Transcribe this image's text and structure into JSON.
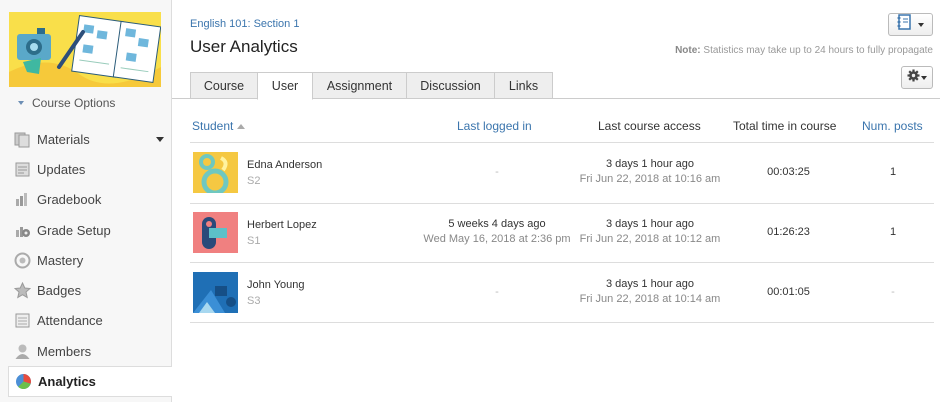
{
  "sidebar": {
    "course_options": "Course Options",
    "items": [
      {
        "label": "Materials",
        "icon": "materials-icon"
      },
      {
        "label": "Updates",
        "icon": "updates-icon"
      },
      {
        "label": "Gradebook",
        "icon": "gradebook-icon"
      },
      {
        "label": "Grade Setup",
        "icon": "grade-setup-icon"
      },
      {
        "label": "Mastery",
        "icon": "mastery-icon"
      },
      {
        "label": "Badges",
        "icon": "badges-icon"
      },
      {
        "label": "Attendance",
        "icon": "attendance-icon"
      },
      {
        "label": "Members",
        "icon": "members-icon"
      },
      {
        "label": "Analytics",
        "icon": "analytics-icon"
      }
    ]
  },
  "header": {
    "breadcrumb": "English 101: Section 1",
    "title": "User Analytics",
    "note_label": "Note:",
    "note_text": " Statistics may take up to 24 hours to fully propagate"
  },
  "tabs": [
    "Course",
    "User",
    "Assignment",
    "Discussion",
    "Links"
  ],
  "table": {
    "headers": [
      "Student",
      "Last logged in",
      "Last course access",
      "Total time in course",
      "Num. posts"
    ],
    "rows": [
      {
        "name": "Edna Anderson",
        "section": "S2",
        "last_login_1": "-",
        "last_login_2": "",
        "access_1": "3 days 1 hour ago",
        "access_2": "Fri Jun 22, 2018 at 10:16 am",
        "time": "00:03:25",
        "posts": "1"
      },
      {
        "name": "Herbert Lopez",
        "section": "S1",
        "last_login_1": "5 weeks 4 days ago",
        "last_login_2": "Wed May 16, 2018 at 2:36 pm",
        "access_1": "3 days 1 hour ago",
        "access_2": "Fri Jun 22, 2018 at 10:12 am",
        "time": "01:26:23",
        "posts": "1"
      },
      {
        "name": "John Young",
        "section": "S3",
        "last_login_1": "-",
        "last_login_2": "",
        "access_1": "3 days 1 hour ago",
        "access_2": "Fri Jun 22, 2018 at 10:14 am",
        "time": "00:01:05",
        "posts": "-"
      }
    ]
  },
  "colors": {
    "accent": "#3b75ad",
    "banner": "#f9df4a"
  }
}
